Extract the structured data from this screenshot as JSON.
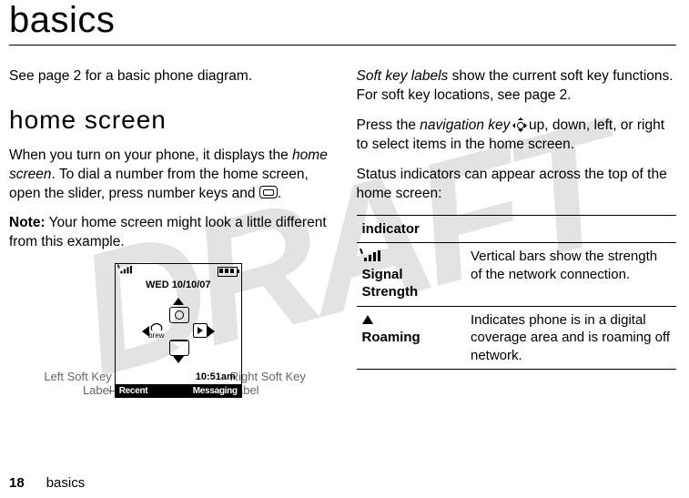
{
  "watermark": "DRAFT",
  "title": "basics",
  "left": {
    "p1": "See page 2 for a basic phone diagram.",
    "h2": "home screen",
    "p2a": "When you turn on your phone, it displays the ",
    "p2b": "home screen",
    "p2c": ". To dial a number from the home screen, open the slider, press number keys and ",
    "p2d": ".",
    "p3a": "Note:",
    "p3b": " Your home screen might look a little different from this example."
  },
  "phone": {
    "date": "WED 10/10/07",
    "time": "10:51am",
    "softleft": "Recent",
    "softright": "Messaging",
    "brew": "brew",
    "callout_left_l1": "Left Soft Key",
    "callout_left_l2": "Label",
    "callout_right_l1": "Right Soft Key",
    "callout_right_l2": "Label"
  },
  "right": {
    "p1a": "Soft key labels",
    "p1b": " show the current soft key functions. For soft key locations, see page 2.",
    "p2a": "Press the ",
    "p2b": "navigation key",
    "p2c": " up, down, left, or right to select items in the home screen.",
    "p3": "Status indicators can appear across the top of the home screen:"
  },
  "table": {
    "header": "indicator",
    "rows": [
      {
        "name": "Signal Strength",
        "desc": "Vertical bars show the strength of the network connection."
      },
      {
        "name": "Roaming",
        "desc": "Indicates phone is in a digital coverage area and is roaming off network."
      }
    ]
  },
  "footer": {
    "page": "18",
    "section": "basics"
  }
}
